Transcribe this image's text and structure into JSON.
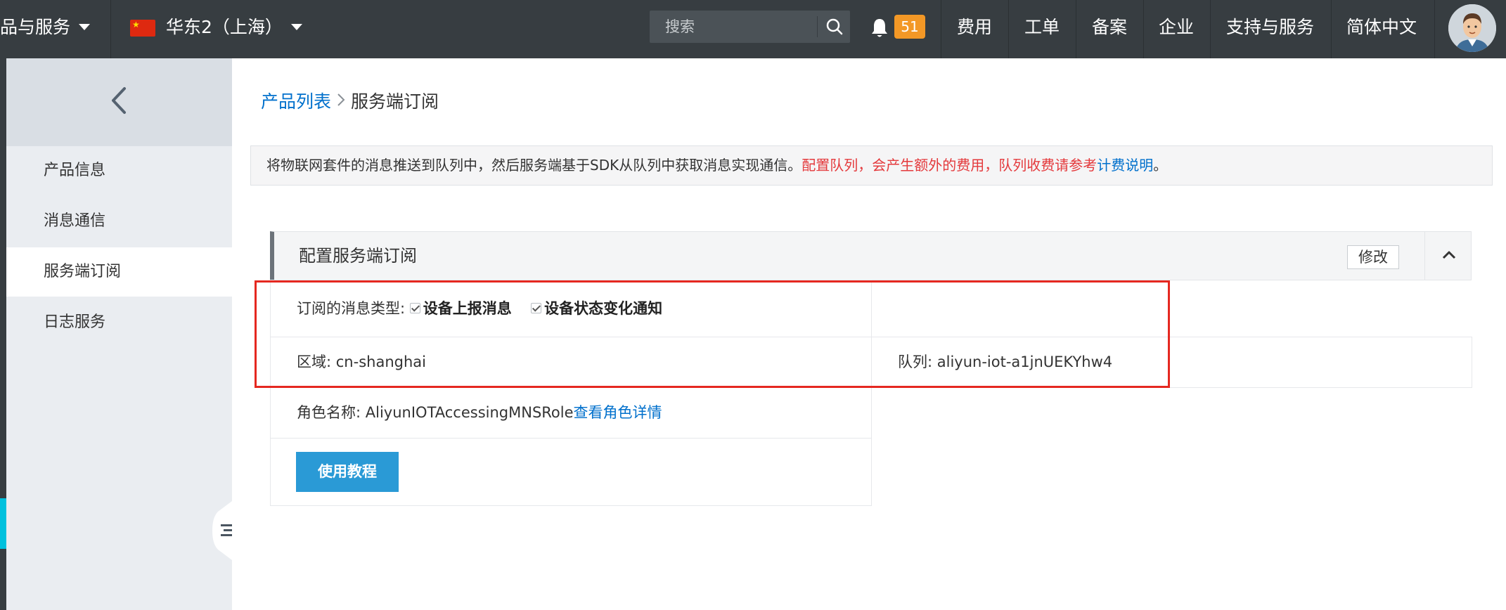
{
  "topbar": {
    "products_label": "品与服务",
    "region_label": "华东2（上海）",
    "search_placeholder": "搜索",
    "notification_count": "51",
    "nav_items": [
      "费用",
      "工单",
      "备案",
      "企业",
      "支持与服务",
      "简体中文"
    ]
  },
  "sidebar": {
    "items": [
      "产品信息",
      "消息通信",
      "服务端订阅",
      "日志服务"
    ],
    "active_index": 2
  },
  "breadcrumb": {
    "parent": "产品列表",
    "current": "服务端订阅"
  },
  "notice": {
    "text": "将物联网套件的消息推送到队列中，然后服务端基于SDK从队列中获取消息实现通信。",
    "warning": "配置队列，会产生额外的费用，队列收费请参考",
    "link": "计费说明",
    "suffix": "。"
  },
  "panel": {
    "title": "配置服务端订阅",
    "edit_label": "修改",
    "message_type_label": "订阅的消息类型:",
    "message_type_1": "设备上报消息",
    "message_type_2": "设备状态变化通知",
    "region_label": "区域:",
    "region_value": "cn-shanghai",
    "queue_label": "队列:",
    "queue_value": "aliyun-iot-a1jnUEKYhw4",
    "role_label": "角色名称:",
    "role_value": "AliyunIOTAccessingMNSRole",
    "role_link": "查看角色详情",
    "tutorial_label": "使用教程"
  },
  "colors": {
    "topbar_bg": "#373d41",
    "accent_blue": "#0070cc",
    "button_blue": "#2a9ad6",
    "warning_red": "#e4393c",
    "badge_orange": "#f39826",
    "highlight_red": "#e52820"
  }
}
